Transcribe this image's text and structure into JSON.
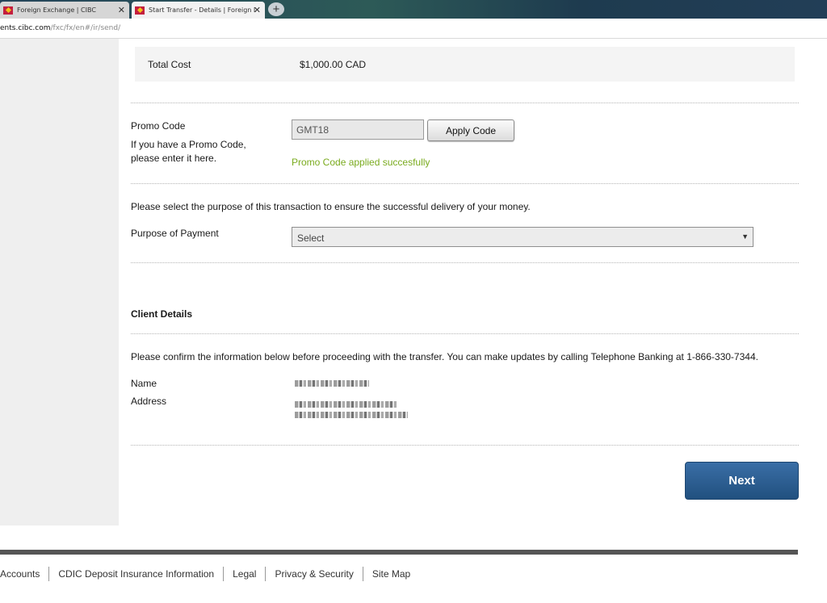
{
  "browser": {
    "tabs": [
      {
        "title": "Foreign Exchange | CIBC",
        "active": false
      },
      {
        "title": "Start Transfer - Details | Foreign I",
        "active": true
      }
    ],
    "url_host": "ents.cibc.com",
    "url_path": "/fxc/fx/en#/ir/send/"
  },
  "summary": {
    "total_cost_label": "Total Cost",
    "total_cost_value": "$1,000.00 CAD"
  },
  "promo": {
    "label": "Promo Code",
    "help_line1": "If you have a Promo Code,",
    "help_line2": "please enter it here.",
    "input_value": "GMT18",
    "apply_label": "Apply Code",
    "success_message": "Promo Code applied succesfully",
    "success_color": "#7aab1e"
  },
  "purpose": {
    "intro": "Please select the purpose of this transaction to ensure the successful delivery of your money.",
    "label": "Purpose of Payment",
    "selected": "Select"
  },
  "client": {
    "title": "Client Details",
    "info": "Please confirm the information below before proceeding with the transfer. You can make updates by calling Telephone Banking at 1-866-330-7344.",
    "name_label": "Name",
    "address_label": "Address"
  },
  "actions": {
    "next_label": "Next",
    "next_color": "#2a5d93"
  },
  "footer": {
    "links": [
      "Accounts",
      "CDIC Deposit Insurance Information",
      "Legal",
      "Privacy & Security",
      "Site Map"
    ]
  }
}
